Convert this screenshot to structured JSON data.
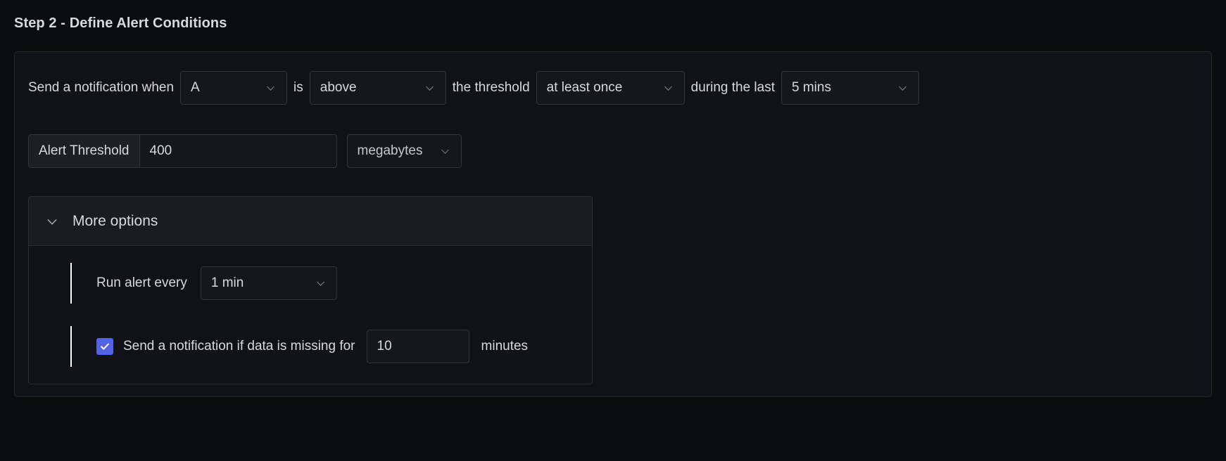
{
  "page": {
    "title": "Step 2 - Define Alert Conditions"
  },
  "colors": {
    "background": "#0b0c0e",
    "panel": "#111217",
    "border": "#33353c",
    "text": "#d8d9da",
    "checkbox_accent": "#5263e8",
    "row_accent": "#ffffff"
  },
  "condition_row": {
    "lead_text": "Send a notification when",
    "query_select": {
      "value": "A",
      "chevron": "chevron-down-icon"
    },
    "is_text": "is",
    "comparator_select": {
      "value": "above",
      "chevron": "chevron-down-icon"
    },
    "threshold_text": "the threshold",
    "frequency_select": {
      "value": "at least once",
      "chevron": "chevron-down-icon"
    },
    "during_text": "during the last",
    "window_select": {
      "value": "5 mins",
      "chevron": "chevron-down-icon"
    }
  },
  "threshold_row": {
    "label": "Alert Threshold",
    "value": "400",
    "placeholder": "",
    "unit_select": {
      "value": "megabytes",
      "chevron": "chevron-down-icon"
    }
  },
  "more_options": {
    "header_label": "More options",
    "expanded": true,
    "chevron": "chevron-down-icon",
    "run_alert": {
      "label": "Run alert every",
      "select": {
        "value": "1 min",
        "chevron": "chevron-down-icon"
      }
    },
    "missing_data": {
      "checked": true,
      "checkbox_icon": "check-icon",
      "label": "Send a notification if data is missing for",
      "value": "10",
      "placeholder": "",
      "suffix": "minutes"
    }
  }
}
